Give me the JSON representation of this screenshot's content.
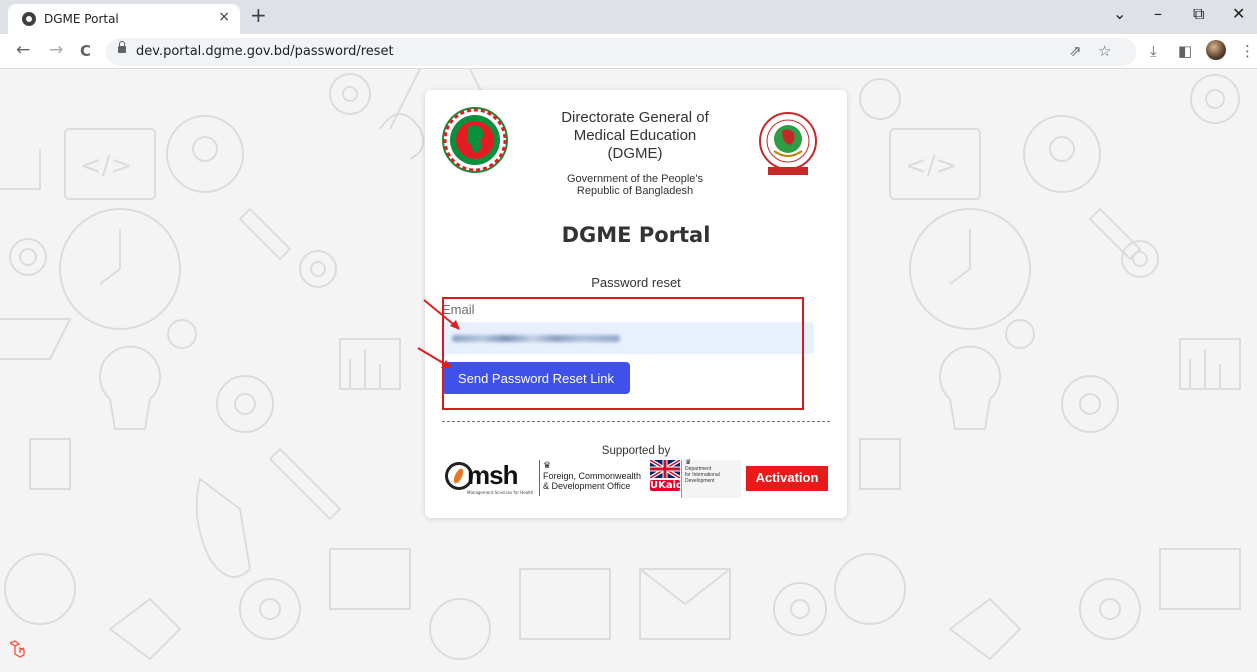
{
  "browser": {
    "tab_title": "DGME Portal",
    "tab_close": "×",
    "new_tab": "+",
    "url": "dev.portal.dgme.gov.bd/password/reset",
    "window_controls": {
      "tab_search": "⌄",
      "minimize": "–",
      "restore": "⧉",
      "close": "✕"
    },
    "nav": {
      "back": "←",
      "forward": "→",
      "reload": "C"
    },
    "toolbar_icons": [
      "share-icon",
      "bookmark-star-icon",
      "download-icon",
      "sidepanel-icon",
      "profile-avatar",
      "kebab-menu-icon"
    ]
  },
  "card": {
    "org_name": [
      "Directorate General of",
      "Medical Education",
      "(DGME)"
    ],
    "gov": [
      "Government of the People's",
      "Republic of Bangladesh"
    ],
    "portal_title": "DGME Portal",
    "form_title": "Password reset",
    "email_label": "Email",
    "email_value": "",
    "send_button": "Send Password Reset Link",
    "supported_by": "Supported by",
    "sponsors": {
      "msh": "msh",
      "msh_sub": "Management Sciences for Health",
      "fcdo": [
        "Foreign, Commonwealth",
        "& Development Office"
      ],
      "ukaid": "UKaid",
      "dfid": [
        "Department",
        "for International",
        "Development"
      ],
      "activation": "Activation"
    }
  },
  "colors": {
    "primary_button": "#3f51e8",
    "annotation_red": "#d81b1b",
    "input_bg": "#e8f0fe",
    "activation_red": "#e81a1a"
  }
}
